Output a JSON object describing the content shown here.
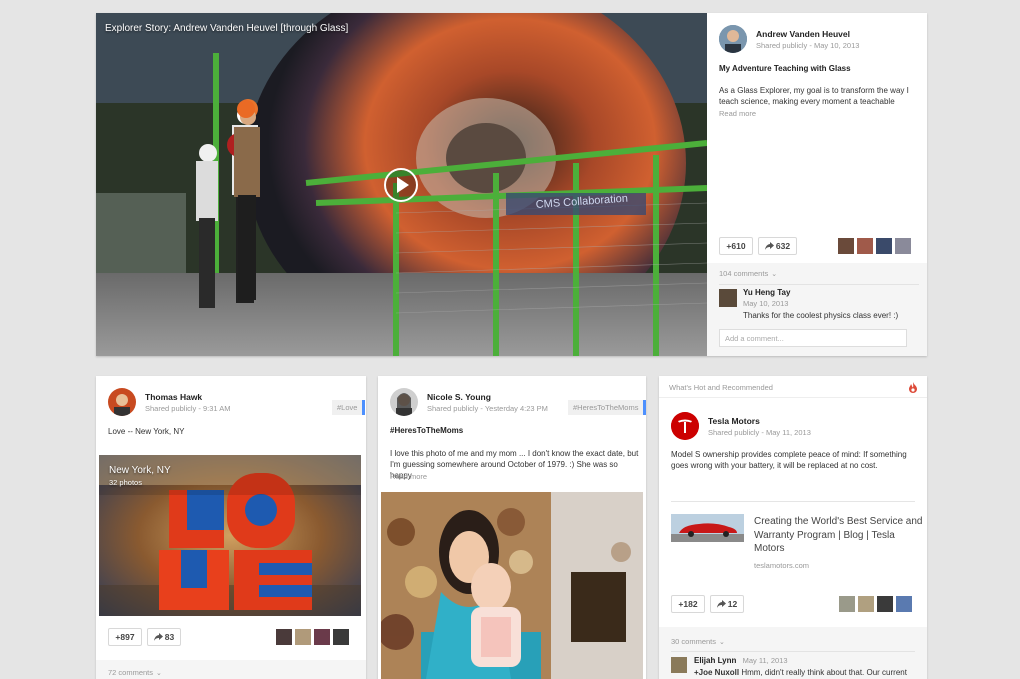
{
  "featured": {
    "overlay_title": "Explorer Story: Andrew Vanden Heuvel [through Glass]",
    "image_text": "CMS Collaboration",
    "author": "Andrew Vanden Heuvel",
    "visibility": "Shared publicly",
    "date": "May 10, 2013",
    "post_title": "My Adventure Teaching with Glass",
    "body": "As a Glass Explorer, my goal is to transform the way I teach science, making every moment a teachable",
    "read_more": "Read more",
    "plus_count": "+610",
    "share_count": "632",
    "comments_label": "104 comments",
    "commenter": "Yu Heng Tay",
    "comment_date": "May 10, 2013",
    "comment_text": "Thanks for the coolest physics class ever! :)",
    "add_comment_placeholder": "Add a comment..."
  },
  "post_hawk": {
    "author": "Thomas Hawk",
    "visibility": "Shared publicly",
    "time": "9:31 AM",
    "tag": "#Love",
    "body": "Love -- New York, NY",
    "album_title": "New York, NY",
    "album_count": "32 photos",
    "plus_count": "+897",
    "share_count": "83",
    "comments_label": "72 comments"
  },
  "post_nicole": {
    "author": "Nicole S. Young",
    "visibility": "Shared publicly",
    "time": "Yesterday 4:23 PM",
    "tag": "#HeresToTheMoms",
    "hashtag_line": "#HeresToTheMoms",
    "body": "I love this photo of me and my mom ... I don't know the exact date, but I'm guessing somewhere around October of 1979. :) She was so happy",
    "read_more": "Read more"
  },
  "post_tesla": {
    "section_label": "What's Hot and Recommended",
    "author": "Tesla Motors",
    "visibility": "Shared publicly",
    "date": "May 11, 2013",
    "body": "Model S ownership provides complete peace of mind: If something goes wrong with your battery, it will be replaced at no cost.",
    "link_title": "Creating the World's Best Service and Warranty Program | Blog | Tesla Motors",
    "link_domain": "teslamotors.com",
    "plus_count": "+182",
    "share_count": "12",
    "comments_label": "30 comments",
    "commenter": "Elijah Lynn",
    "comment_date": "May 11, 2013",
    "comment_mention": "+Joe Nuxoll",
    "comment_text": "Hmm, didn't really think about that. Our current"
  },
  "colors": {
    "accent_blue": "#4d90fe",
    "tesla_red": "#cc0000",
    "hot_orange": "#dd4b39"
  }
}
